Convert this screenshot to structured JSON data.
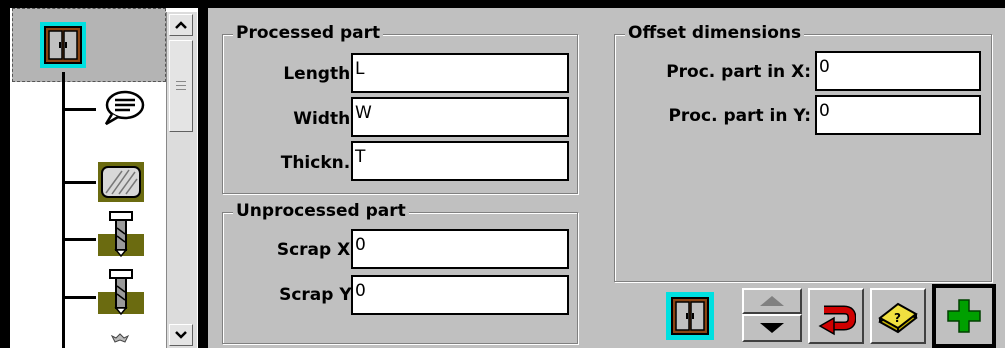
{
  "processed_part": {
    "title": "Processed part",
    "length_label": "Length:",
    "length_value": "L",
    "width_label": "Width:",
    "width_value": "W",
    "thickness_label": "Thickn.:",
    "thickness_value": "T"
  },
  "unprocessed_part": {
    "title": "Unprocessed part",
    "scrap_x_label": "Scrap X:",
    "scrap_x_value": "0",
    "scrap_y_label": "Scrap Y:",
    "scrap_y_value": "0"
  },
  "offset_dimensions": {
    "title": "Offset dimensions",
    "proc_x_label": "Proc. part in X:",
    "proc_x_value": "0",
    "proc_y_label": "Proc. part in Y:",
    "proc_y_value": "0"
  },
  "tree": {
    "items": [
      {
        "icon": "cabinet-icon"
      },
      {
        "icon": "comment-bubble-icon"
      },
      {
        "icon": "panel-hatched-icon"
      },
      {
        "icon": "drill-icon"
      },
      {
        "icon": "drill-icon"
      },
      {
        "icon": "sawblade-icon"
      }
    ]
  },
  "toolbar": {
    "icons": [
      "cabinet-icon",
      "move-up-icon",
      "move-down-icon",
      "undo-icon",
      "help-book-icon",
      "add-icon"
    ]
  },
  "colors": {
    "background": "#c0c0c0",
    "input_bg": "#ffffff",
    "add_green": "#00a000",
    "undo_red": "#d00000",
    "cabinet_brown": "#8b4513",
    "cabinet_cyan": "#00e0e0"
  }
}
